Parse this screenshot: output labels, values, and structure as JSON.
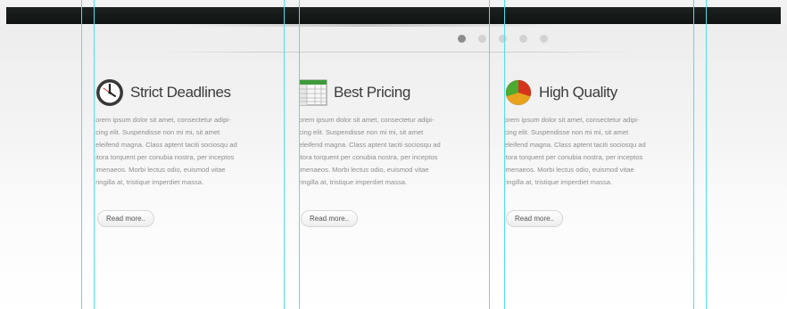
{
  "slider": {
    "dots": 5,
    "active_index": 0
  },
  "features": [
    {
      "icon": "clock-icon",
      "title": "Strict Deadlines",
      "lines": [
        "orem ipsum dolor sit amet, consectetur adipi-",
        "cing elit. Suspendisse non mi mi, sit amet",
        "eleifend magna. Class aptent taciti sociosqu ad",
        "itora torquent per conubia nostra, per inceptos",
        "imenaeos. Morbi lectus odio, euismod vitae",
        "ringilla at, tristique imperdiet massa."
      ],
      "button": "Read more.."
    },
    {
      "icon": "spreadsheet-icon",
      "title": "Best Pricing",
      "lines": [
        "orem ipsum dolor sit amet, consectetur adipi-",
        "cing elit. Suspendisse non mi mi, sit amet",
        "eleifend magna. Class aptent taciti sociosqu ad",
        "itora torquent per conubia nostra, per inceptos",
        "imenaeos. Morbi lectus odio, euismod vitae",
        "ringilla at, tristique imperdiet massa."
      ],
      "button": "Read more.."
    },
    {
      "icon": "pie-chart-icon",
      "title": "High Quality",
      "lines": [
        "orem ipsum dolor sit amet, consectetur adipi-",
        "cing elit. Suspendisse non mi mi, sit amet",
        "eleifend magna. Class aptent taciti sociosqu ad",
        "itora torquent per conubia nostra, per inceptos",
        "imenaeos. Morbi lectus odio, euismod vitae",
        "ringilla at, tristique imperdiet massa."
      ],
      "button": "Read more.."
    }
  ],
  "colors": {
    "topbar": "#121716",
    "guide_line": "#4fe0ea",
    "dot_active": "#8c8c8c",
    "dot_inactive": "#d2d2d2"
  }
}
